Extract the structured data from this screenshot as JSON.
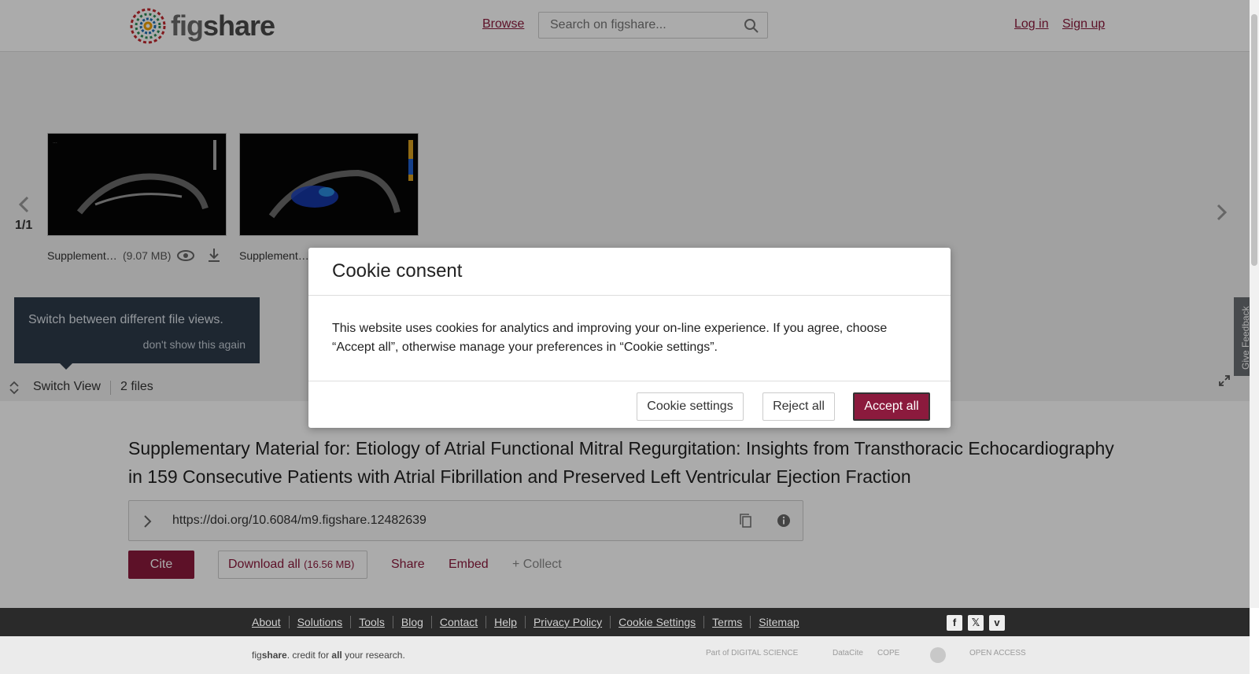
{
  "header": {
    "logo_text_light": "fig",
    "logo_text_bold": "share",
    "browse": "Browse",
    "search_placeholder": "Search on figshare...",
    "login": "Log in",
    "signup": "Sign up"
  },
  "viewer": {
    "pager": "1/1",
    "files": [
      {
        "name": "Supplement…",
        "size": "(9.07 MB)"
      },
      {
        "name": "Supplement…"
      }
    ],
    "tooltip_text": "Switch between different file views.",
    "tooltip_dismiss": "don't show this again",
    "switch_view": "Switch View",
    "file_count": "2 files"
  },
  "feedback": "Give Feedback",
  "article": {
    "title": "Supplementary Material for: Etiology of Atrial Functional Mitral Regurgitation: Insights from Transthoracic Echocardiography in 159 Consecutive Patients with Atrial Fibrillation and Preserved Left Ventricular Ejection Fraction",
    "doi": "https://doi.org/10.6084/m9.figshare.12482639",
    "cite": "Cite",
    "download_all": "Download all",
    "download_size": "(16.56 MB)",
    "share": "Share",
    "embed": "Embed",
    "collect": "+ Collect"
  },
  "footer": {
    "links": [
      "About",
      "Solutions",
      "Tools",
      "Blog",
      "Contact",
      "Help",
      "Privacy Policy",
      "Cookie Settings",
      "Terms",
      "Sitemap"
    ],
    "credit_1": "fig",
    "credit_2": "share",
    "credit_3": ". credit for ",
    "credit_4": "all",
    "credit_5": " your research.",
    "partners": [
      "Part of DIGITAL SCIENCE",
      "DataCite",
      "COPE",
      "OPEN ACCESS"
    ]
  },
  "cookie_modal": {
    "title": "Cookie consent",
    "body": "This website uses cookies for analytics and improving your on-line experience. If you agree, choose “Accept all”, otherwise manage your preferences in “Cookie settings”.",
    "settings": "Cookie settings",
    "reject": "Reject all",
    "accept": "Accept all"
  },
  "colors": {
    "brand": "#8b1a3d",
    "tooltip_bg": "#2e3b4a",
    "footer_bg": "#2a2a2a"
  }
}
